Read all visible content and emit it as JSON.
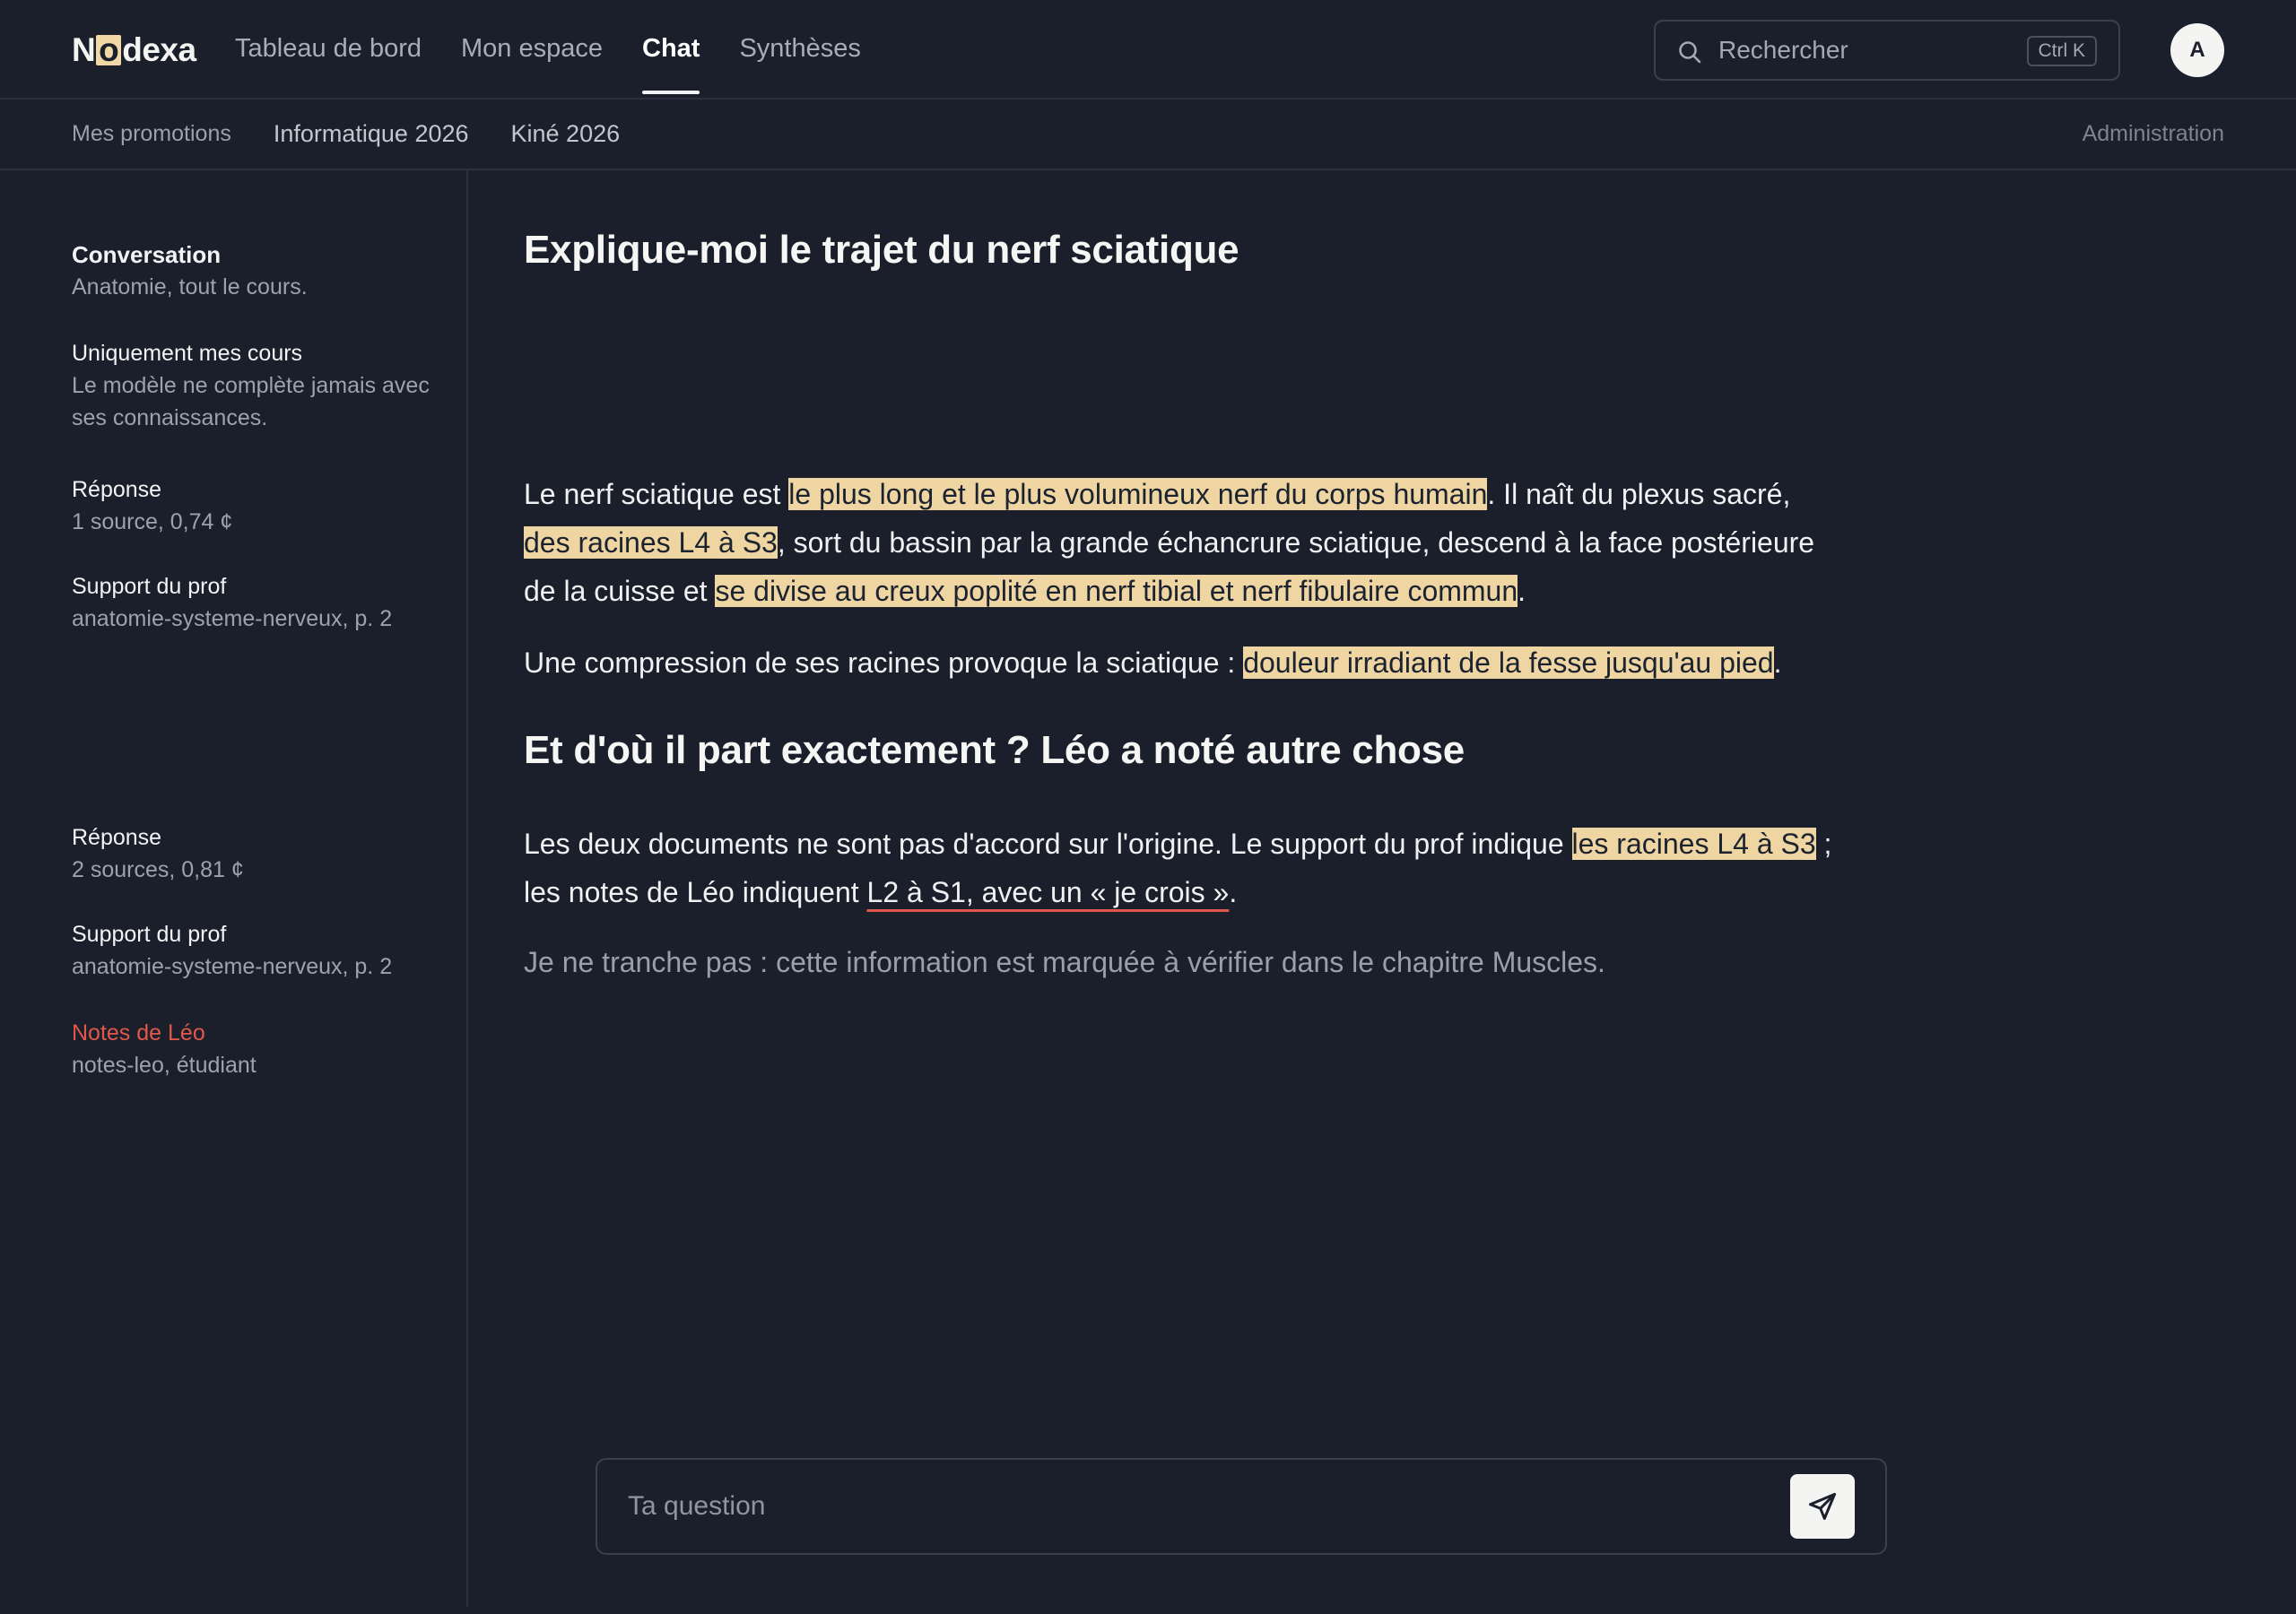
{
  "app": {
    "logo": {
      "pre": "N",
      "mark": "o",
      "post": "dexa"
    },
    "nav": [
      {
        "label": "Tableau de bord"
      },
      {
        "label": "Mon espace"
      },
      {
        "label": "Chat",
        "active": true
      },
      {
        "label": "Synthèses"
      }
    ],
    "search": {
      "placeholder": "Rechercher",
      "shortcut": "Ctrl K"
    },
    "avatar": "A"
  },
  "subnav": {
    "items": [
      "Mes promotions",
      "Informatique 2026",
      "Kiné 2026"
    ],
    "admin": "Administration"
  },
  "sidebar": {
    "conversation": {
      "title": "Conversation",
      "sub": "Anatomie, tout le cours."
    },
    "mode": {
      "title": "Uniquement mes cours",
      "sub": "Le modèle ne complète jamais avec ses connaissances."
    },
    "answer1": {
      "title": "Réponse",
      "sub": "1 source, 0,74 ¢"
    },
    "answer1_source": {
      "title": "Support du prof",
      "sub": "anatomie-systeme-nerveux, p. 2"
    },
    "answer2": {
      "title": "Réponse",
      "sub": "2 sources, 0,81 ¢"
    },
    "answer2_source1": {
      "title": "Support du prof",
      "sub": "anatomie-systeme-nerveux, p. 2"
    },
    "answer2_source2": {
      "title": "Notes de Léo",
      "sub": "notes-leo, étudiant"
    }
  },
  "chat": {
    "q1": "Explique-moi le trajet du nerf sciatique",
    "a1_p1": [
      "Le nerf sciatique est ",
      "le plus long et le plus volumineux nerf du corps humain",
      ". Il naît du plexus sacré, ",
      "des racines L4 à S3",
      ", sort du bassin par la grande échancrure sciatique, descend à la face postérieure de la cuisse et ",
      "se divise au creux poplité en nerf tibial et nerf fibulaire commun",
      "."
    ],
    "a1_p2": [
      "Une compression de ses racines provoque la sciatique : ",
      "douleur irradiant de la fesse jusqu'au pied",
      "."
    ],
    "q2": "Et d'où il part exactement ? Léo a noté autre chose",
    "a2_p1": [
      "Les deux documents ne sont pas d'accord sur l'origine. Le support du prof indique ",
      "les racines L4 à S3",
      " ; les notes de Léo indiquent ",
      "L2 à S1, avec un « je crois »",
      "."
    ],
    "a2_p2": "Je ne tranche pas : cette information est marquée à vérifier dans le chapitre Muscles."
  },
  "composer": {
    "placeholder": "Ta question"
  },
  "colors": {
    "background": "#1a1f2b",
    "highlight": "#efd5a1",
    "warning": "#e1584a"
  }
}
